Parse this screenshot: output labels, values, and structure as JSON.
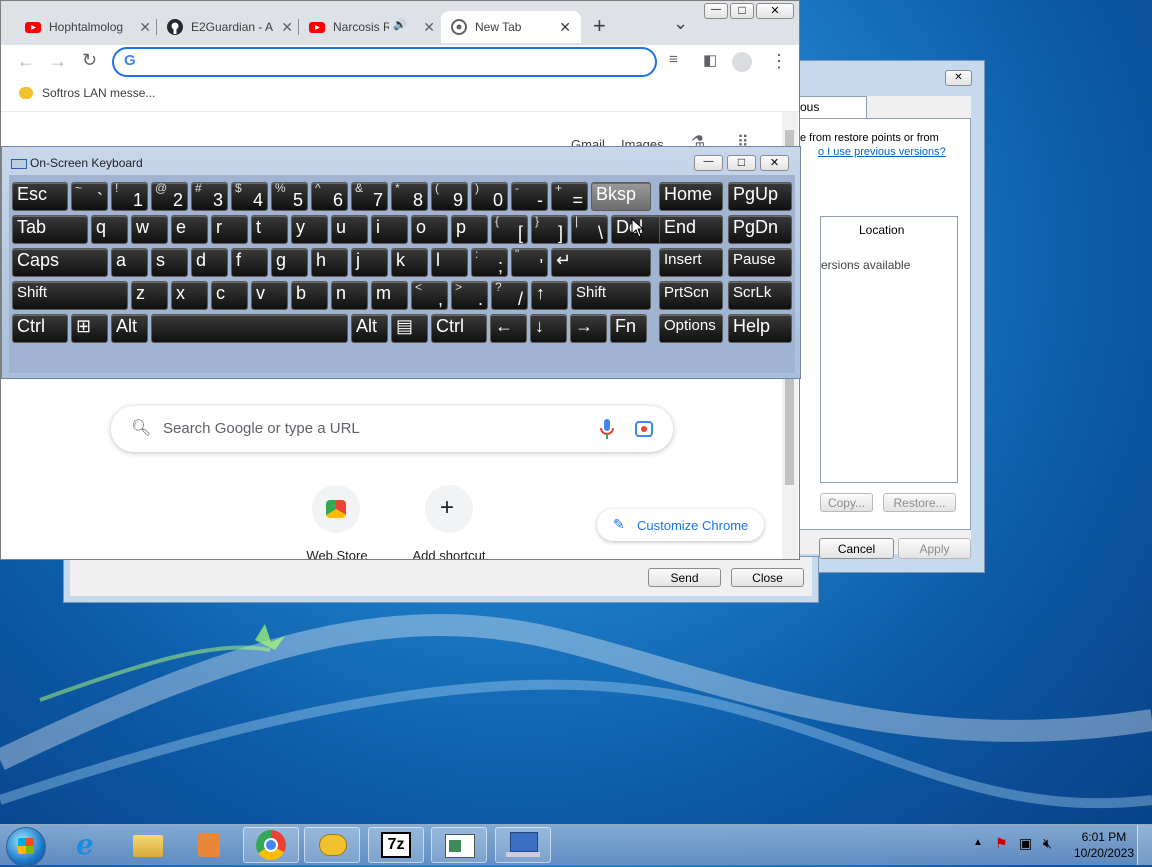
{
  "chrome": {
    "tabs": [
      {
        "label": "Hophtalmolog",
        "icon": "youtube-icon",
        "close": "✕"
      },
      {
        "label": "E2Guardian - A",
        "icon": "github-icon",
        "close": "✕"
      },
      {
        "label": "Narcosis R",
        "icon": "youtube-icon",
        "close": "✕",
        "audio": "🔊"
      },
      {
        "label": "New Tab",
        "icon": "chrome-icon",
        "close": "✕"
      }
    ],
    "new_tab": "+",
    "tab_search": "⌄",
    "omnibox_value": "",
    "bookmark": "Softros LAN messe...",
    "ntp": {
      "top_links": [
        "Gmail",
        "Images"
      ],
      "search_placeholder": "Search Google or type a URL",
      "shortcuts": [
        "Web Store",
        "Add shortcut"
      ],
      "customize": "Customize Chrome"
    }
  },
  "window_controls": {
    "minimize": "—",
    "maximize": "□",
    "close": "✕"
  },
  "osk": {
    "title": "On-Screen Keyboard",
    "rows": [
      [
        {
          "label": "Esc"
        },
        {
          "sub": "~",
          "main": "`"
        },
        {
          "sub": "!",
          "main": "1"
        },
        {
          "sub": "@",
          "main": "2"
        },
        {
          "sub": "#",
          "main": "3"
        },
        {
          "sub": "$",
          "main": "4"
        },
        {
          "sub": "%",
          "main": "5"
        },
        {
          "sub": "^",
          "main": "6"
        },
        {
          "sub": "&",
          "main": "7"
        },
        {
          "sub": "*",
          "main": "8"
        },
        {
          "sub": "(",
          "main": "9"
        },
        {
          "sub": ")",
          "main": "0"
        },
        {
          "sub": "-",
          "main": "-"
        },
        {
          "sub": "+",
          "main": "="
        },
        {
          "label": "Bksp"
        },
        {
          "label": "Home"
        },
        {
          "label": "PgUp"
        }
      ],
      [
        {
          "label": "Tab"
        },
        {
          "label": "q"
        },
        {
          "label": "w"
        },
        {
          "label": "e"
        },
        {
          "label": "r"
        },
        {
          "label": "t"
        },
        {
          "label": "y"
        },
        {
          "label": "u"
        },
        {
          "label": "i"
        },
        {
          "label": "o"
        },
        {
          "label": "p"
        },
        {
          "sub": "{",
          "main": "["
        },
        {
          "sub": "}",
          "main": "]"
        },
        {
          "sub": "|",
          "main": "\\"
        },
        {
          "label": "Del"
        },
        {
          "label": "End"
        },
        {
          "label": "PgDn"
        }
      ],
      [
        {
          "label": "Caps"
        },
        {
          "label": "a"
        },
        {
          "label": "s"
        },
        {
          "label": "d"
        },
        {
          "label": "f"
        },
        {
          "label": "g"
        },
        {
          "label": "h"
        },
        {
          "label": "j"
        },
        {
          "label": "k"
        },
        {
          "label": "l"
        },
        {
          "sub": ":",
          "main": ";"
        },
        {
          "sub": "\"",
          "main": "'"
        },
        {
          "label": "↵"
        },
        {
          "label": "Insert"
        },
        {
          "label": "Pause"
        }
      ],
      [
        {
          "label": "Shift"
        },
        {
          "label": "z"
        },
        {
          "label": "x"
        },
        {
          "label": "c"
        },
        {
          "label": "v"
        },
        {
          "label": "b"
        },
        {
          "label": "n"
        },
        {
          "label": "m"
        },
        {
          "sub": "<",
          "main": ","
        },
        {
          "sub": ">",
          "main": "."
        },
        {
          "sub": "?",
          "main": "/"
        },
        {
          "label": "↑"
        },
        {
          "label": "Shift"
        },
        {
          "label": "PrtScn"
        },
        {
          "label": "ScrLk"
        }
      ],
      [
        {
          "label": "Ctrl"
        },
        {
          "label": "⊞"
        },
        {
          "label": "Alt"
        },
        {
          "label": ""
        },
        {
          "label": "Alt"
        },
        {
          "label": "▤"
        },
        {
          "label": "Ctrl"
        },
        {
          "label": "←"
        },
        {
          "label": "↓"
        },
        {
          "label": "→"
        },
        {
          "label": "Fn"
        },
        {
          "label": "Options"
        },
        {
          "label": "Help"
        }
      ]
    ]
  },
  "prev_versions": {
    "tab": "ous Versions",
    "text1": "e from restore points or from",
    "link": "o I use previous versions?",
    "col_location": "Location",
    "empty": "ersions available",
    "copy": "Copy...",
    "restore": "Restore...",
    "cancel": "Cancel",
    "apply": "Apply"
  },
  "message_window": {
    "send": "Send",
    "close": "Close"
  },
  "taskbar": {
    "time": "6:01 PM",
    "date": "10/20/2023",
    "apps": [
      "start-orb",
      "ie-icon",
      "explorer-icon",
      "media-player-icon",
      "chrome-icon",
      "softros-icon",
      "7zip-icon",
      "windows-app-icon",
      "network-app-icon"
    ]
  }
}
